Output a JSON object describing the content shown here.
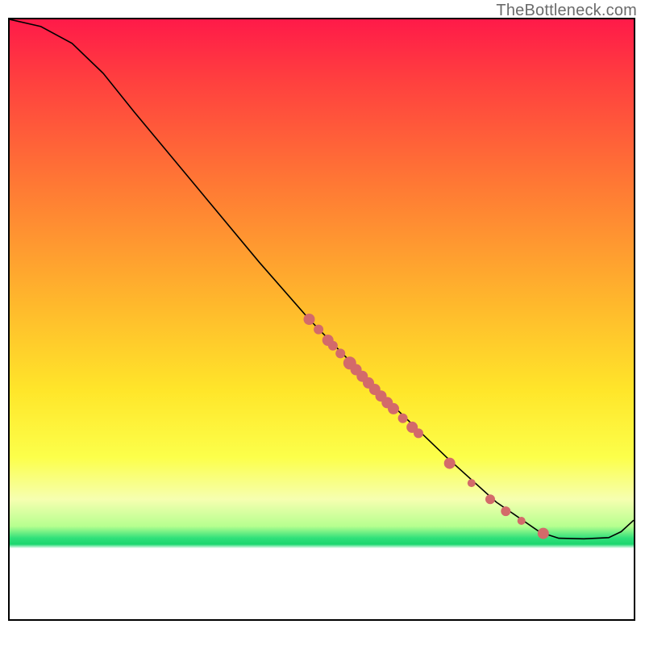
{
  "watermark": "TheBottleneck.com",
  "chart_data": {
    "type": "line",
    "title": "",
    "xlabel": "",
    "ylabel": "",
    "xlim": [
      0,
      100
    ],
    "ylim": [
      0,
      100
    ],
    "grid": false,
    "legend": false,
    "curve": [
      {
        "x": 0,
        "y": 100.0
      },
      {
        "x": 5,
        "y": 98.8
      },
      {
        "x": 10,
        "y": 96.0
      },
      {
        "x": 15,
        "y": 91.0
      },
      {
        "x": 20,
        "y": 84.5
      },
      {
        "x": 30,
        "y": 72.0
      },
      {
        "x": 40,
        "y": 59.5
      },
      {
        "x": 48,
        "y": 50.0
      },
      {
        "x": 55,
        "y": 42.5
      },
      {
        "x": 62,
        "y": 35.0
      },
      {
        "x": 70,
        "y": 27.0
      },
      {
        "x": 78,
        "y": 19.5
      },
      {
        "x": 85,
        "y": 14.5
      },
      {
        "x": 88,
        "y": 13.5
      },
      {
        "x": 92,
        "y": 13.4
      },
      {
        "x": 96,
        "y": 13.6
      },
      {
        "x": 98,
        "y": 14.6
      },
      {
        "x": 100,
        "y": 16.5
      }
    ],
    "points": [
      {
        "x": 48.0,
        "y": 50.0,
        "r": 7
      },
      {
        "x": 49.5,
        "y": 48.3,
        "r": 6
      },
      {
        "x": 51.0,
        "y": 46.5,
        "r": 7
      },
      {
        "x": 51.8,
        "y": 45.6,
        "r": 6
      },
      {
        "x": 53.0,
        "y": 44.3,
        "r": 6
      },
      {
        "x": 54.5,
        "y": 42.7,
        "r": 8
      },
      {
        "x": 55.5,
        "y": 41.6,
        "r": 7
      },
      {
        "x": 56.5,
        "y": 40.5,
        "r": 7
      },
      {
        "x": 57.5,
        "y": 39.4,
        "r": 7
      },
      {
        "x": 58.5,
        "y": 38.3,
        "r": 7
      },
      {
        "x": 59.5,
        "y": 37.2,
        "r": 7
      },
      {
        "x": 60.5,
        "y": 36.1,
        "r": 7
      },
      {
        "x": 61.5,
        "y": 35.1,
        "r": 7
      },
      {
        "x": 63.0,
        "y": 33.5,
        "r": 6
      },
      {
        "x": 64.5,
        "y": 32.0,
        "r": 7
      },
      {
        "x": 65.5,
        "y": 31.0,
        "r": 6
      },
      {
        "x": 70.5,
        "y": 26.0,
        "r": 7
      },
      {
        "x": 74.0,
        "y": 22.7,
        "r": 5
      },
      {
        "x": 77.0,
        "y": 20.0,
        "r": 6
      },
      {
        "x": 79.5,
        "y": 18.0,
        "r": 6
      },
      {
        "x": 82.0,
        "y": 16.4,
        "r": 5
      },
      {
        "x": 85.5,
        "y": 14.3,
        "r": 7
      }
    ]
  }
}
